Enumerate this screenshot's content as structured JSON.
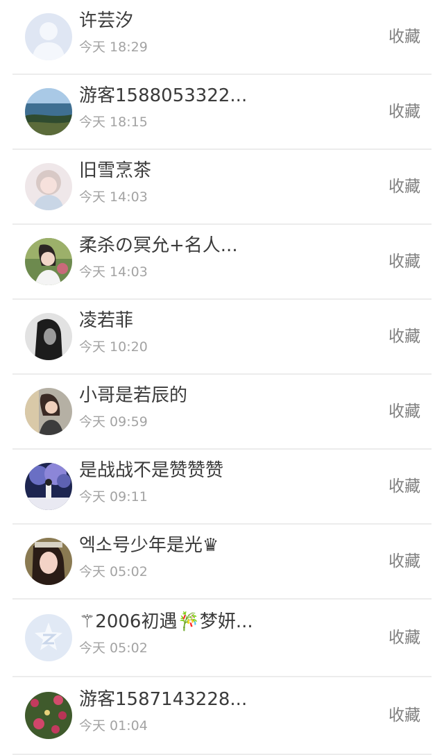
{
  "favorite_label": "收藏",
  "contacts": [
    {
      "name": "许芸汐",
      "time": "今天 18:29",
      "avatar": "default-person"
    },
    {
      "name": "游客1588053322...",
      "time": "今天 18:15",
      "avatar": "seaside"
    },
    {
      "name": "旧雪烹茶",
      "time": "今天 14:03",
      "avatar": "girl-light"
    },
    {
      "name": "柔杀の冥允+名人...",
      "time": "今天 14:03",
      "avatar": "girl-garden"
    },
    {
      "name": "凌若菲",
      "time": "今天 10:20",
      "avatar": "dark-portrait"
    },
    {
      "name": "小哥是若辰的",
      "time": "今天 09:59",
      "avatar": "girl-room"
    },
    {
      "name": "是战战不是赞赞赞",
      "time": "今天 09:11",
      "avatar": "night-tree"
    },
    {
      "name": "엑소号少年是光♛",
      "time": "今天 05:02",
      "avatar": "girl-closeup"
    },
    {
      "name": "⚚2006初遇🎋梦妍...",
      "time": "今天 05:02",
      "avatar": "default-logo"
    },
    {
      "name": "游客1587143228...",
      "time": "今天 01:04",
      "avatar": "roses"
    }
  ]
}
